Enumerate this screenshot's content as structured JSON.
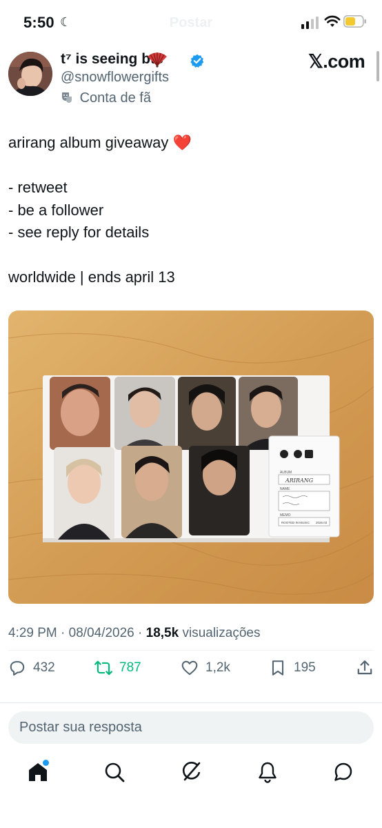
{
  "status_bar": {
    "time": "5:50",
    "ghost_title": "Postar"
  },
  "header": {
    "display_name": "t⁷ is seeing bts",
    "handle": "@snowflowergifts",
    "badge": "Conta de fã",
    "brand": "𝕏.com"
  },
  "tweet": {
    "text": "arirang album giveaway ❤️\n\n- retweet\n- be a follower\n- see reply for details\n\nworldwide | ends april 13",
    "time": "4:29 PM",
    "date": "08/04/2026",
    "views_count": "18,5k",
    "views_label": "visualizações"
  },
  "photo": {
    "album_label": "ALBUM",
    "album_name": "ARIRANG",
    "name_label": "NAME",
    "memo_label": "MEMO",
    "memo_left": "ROOTED IN MUSIC",
    "memo_right": "2026.03"
  },
  "actions": {
    "replies": "432",
    "retweets": "787",
    "likes": "1,2k",
    "bookmarks": "195"
  },
  "reply_box": {
    "placeholder": "Postar sua resposta"
  },
  "colors": {
    "accent": "#1d9bf0",
    "retweet": "#00ba7c",
    "text": "#0f1419",
    "secondary": "#536471"
  }
}
